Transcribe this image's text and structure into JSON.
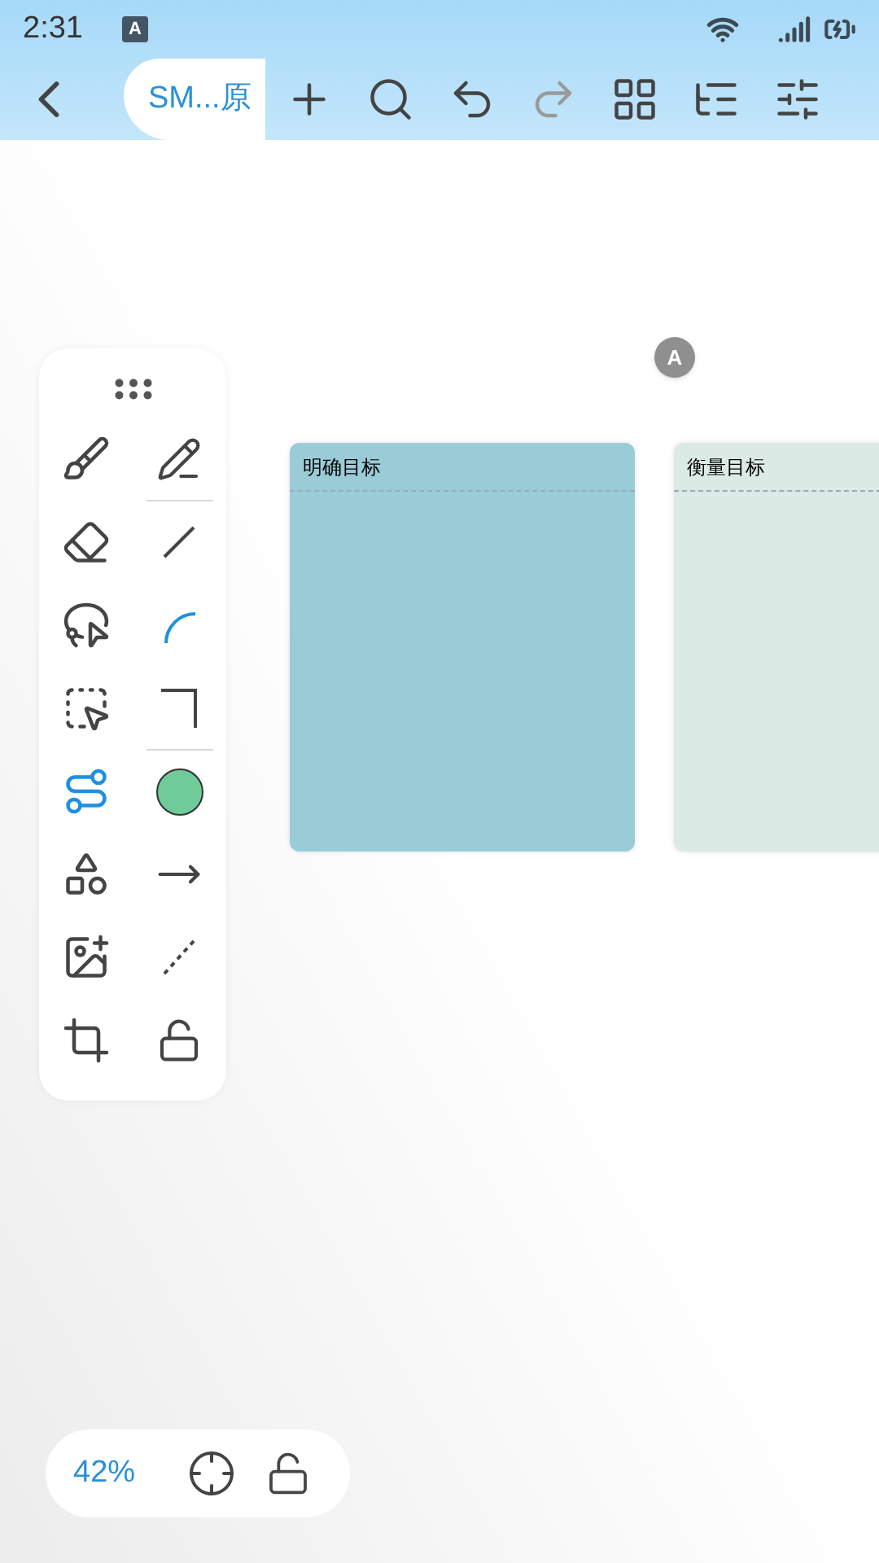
{
  "status_bar": {
    "time": "2:31",
    "notification": "A"
  },
  "toolbar": {
    "tab": {
      "label": "SM...原",
      "selected": true
    },
    "redo": {
      "disabled": true
    }
  },
  "tools_left": [
    {
      "kind": "brush",
      "selected": false
    },
    {
      "kind": "eraser",
      "selected": false
    },
    {
      "kind": "lasso",
      "selected": false
    },
    {
      "kind": "box-select",
      "selected": false
    },
    {
      "kind": "connector",
      "selected": true
    },
    {
      "kind": "shapes",
      "selected": false
    },
    {
      "kind": "image-add",
      "selected": false
    },
    {
      "kind": "image-crop",
      "selected": false
    }
  ],
  "tools_right": [
    {
      "kind": "pencil",
      "selected": false
    },
    {
      "kind": "line",
      "selected": false
    },
    {
      "kind": "arc",
      "selected": true
    },
    {
      "kind": "corner",
      "selected": false
    },
    {
      "kind": "color",
      "color": "#6fcb9a"
    },
    {
      "kind": "arrow",
      "selected": false
    },
    {
      "kind": "dashed",
      "selected": false
    },
    {
      "kind": "lock",
      "selected": false
    }
  ],
  "cursor": {
    "label": "A"
  },
  "cards": [
    {
      "title": "明确目标",
      "color": "#9accd8"
    },
    {
      "title": "衡量目标",
      "color": "#dbeae4"
    }
  ],
  "zoom": {
    "label": "42%"
  }
}
